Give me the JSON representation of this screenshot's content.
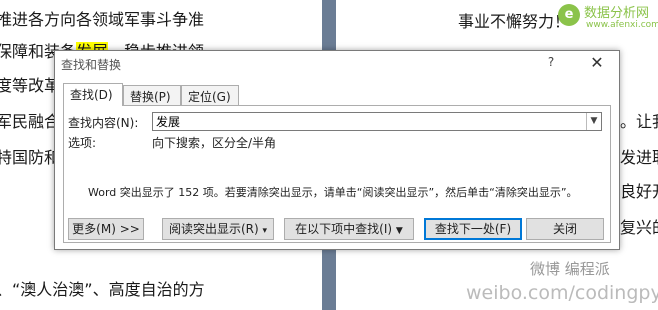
{
  "document": {
    "left_lines": [
      {
        "pre": "推进各方向各领域军事斗争准",
        "hl": "",
        "post": ""
      },
      {
        "pre": "保障和装备",
        "hl": "发展",
        "post": "，稳步推进领"
      },
      {
        "pre": "度等改革",
        "hl": "",
        "post": ""
      },
      {
        "pre": "军民融合",
        "hl": "",
        "post": ""
      },
      {
        "pre": "特国防和",
        "hl": "",
        "post": ""
      },
      {
        "pre": "、“澳人治澳”、高度自治的方",
        "hl": "",
        "post": ""
      }
    ],
    "right_lines": [
      "事业不懈努力！",
      "。让我",
      "发进取",
      "良好开",
      "复兴的"
    ]
  },
  "watermarks": {
    "top_title": "数据分析网",
    "top_sub": "www.afenxi.com",
    "weibo_logo": "微博 编程派",
    "weibo_url": "weibo.com/codingpy"
  },
  "dialog": {
    "title": "查找和替换",
    "help": "?",
    "close": "✕",
    "tabs": [
      "查找(D)",
      "替换(P)",
      "定位(G)"
    ],
    "find_label": "查找内容(N):",
    "find_value": "发展",
    "options_label": "选项:",
    "options_value": "向下搜索，区分全/半角",
    "status": "Word 突出显示了 152 项。若要清除突出显示，请单击“阅读突出显示”，然后单击“清除突出显示”。",
    "buttons": {
      "more": "更多(M) >>",
      "reading_highlight": "阅读突出显示(R)",
      "find_in": "在以下项中查找(I)",
      "find_next": "查找下一处(F)",
      "close": "关闭"
    }
  }
}
